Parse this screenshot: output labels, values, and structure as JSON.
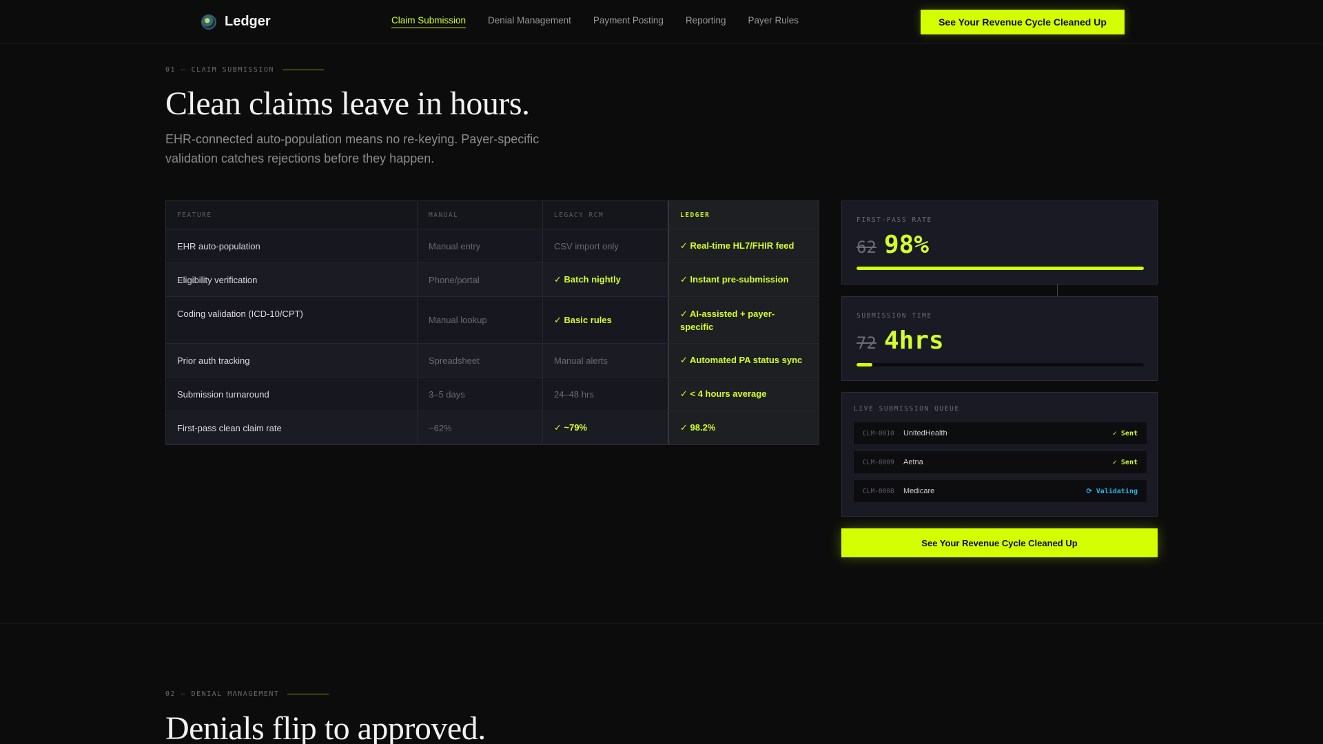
{
  "nav": {
    "brand": "Ledger",
    "links": [
      {
        "label": "Claim Submission",
        "active": true
      },
      {
        "label": "Denial Management"
      },
      {
        "label": "Payment Posting"
      },
      {
        "label": "Reporting"
      },
      {
        "label": "Payer Rules"
      }
    ],
    "cta": "See Your Revenue Cycle Cleaned Up"
  },
  "section1": {
    "eyebrow": "01 — CLAIM SUBMISSION",
    "title": "Clean claims leave in hours.",
    "lede": "EHR-connected auto-population means no re-keying. Payer-specific validation catches rejections before they happen."
  },
  "table": {
    "headers": [
      "FEATURE",
      "MANUAL",
      "LEGACY RCM",
      "LEDGER"
    ],
    "rows": [
      [
        "EHR auto-population",
        "Manual entry",
        "CSV import only",
        "✓ Real-time HL7/FHIR feed"
      ],
      [
        "Eligibility verification",
        "Phone/portal",
        "✓ Batch nightly",
        "✓ Instant pre-submission"
      ],
      [
        "Coding validation (ICD-10/CPT)",
        "Manual lookup",
        "✓ Basic rules",
        "✓ AI-assisted + payer-specific"
      ],
      [
        "Prior auth tracking",
        "Spreadsheet",
        "Manual alerts",
        "✓ Automated PA status sync"
      ],
      [
        "Submission turnaround",
        "3–5 days",
        "24–48 hrs",
        "✓ < 4 hours average"
      ],
      [
        "First-pass clean claim rate",
        "~62%",
        "✓ ~79%",
        "✓ 98.2%"
      ]
    ]
  },
  "metrics": {
    "first_pass": {
      "label": "FIRST-PASS RATE",
      "old": "62",
      "new": "98%",
      "fill": 1.0
    },
    "submission_time": {
      "label": "SUBMISSION TIME",
      "old": "72",
      "new": "4hrs",
      "fill": 0.055
    }
  },
  "queue": {
    "label": "LIVE SUBMISSION QUEUE",
    "items": [
      {
        "id": "CLM-0010",
        "payer": "UnitedHealth",
        "status": "✓ Sent",
        "kind": "sent"
      },
      {
        "id": "CLM-0009",
        "payer": "Aetna",
        "status": "✓ Sent",
        "kind": "sent"
      },
      {
        "id": "CLM-0008",
        "payer": "Medicare",
        "status": "⟳ Validating",
        "kind": "validating"
      }
    ]
  },
  "cta_bottom": "See Your Revenue Cycle Cleaned Up",
  "section2": {
    "eyebrow": "02 — DENIAL MANAGEMENT",
    "title": "Denials flip to approved."
  },
  "colors": {
    "accent": "#d4ff00",
    "validating": "#2ab4e8",
    "background": "#0c0c0c"
  }
}
